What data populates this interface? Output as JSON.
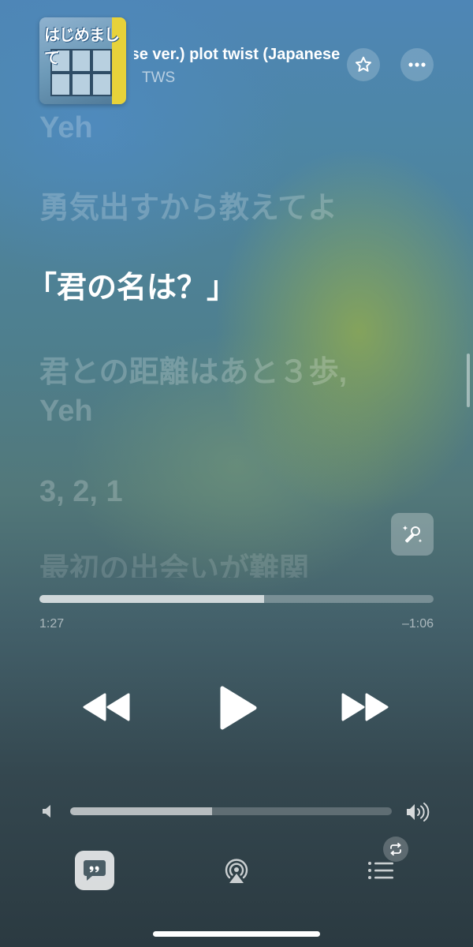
{
  "header": {
    "album_art_title": "はじめまして",
    "track_title": "(Japanese ver.)        plot twist (Japanese ver.)",
    "artist": "TWS"
  },
  "icons": {
    "favorite": "star-icon",
    "more": "ellipsis-icon",
    "sing": "karaoke-mic-icon",
    "rewind": "backward-icon",
    "play": "play-icon",
    "forward": "forward-icon",
    "volume_low": "speaker-low-icon",
    "volume_high": "speaker-high-icon",
    "lyrics": "lyrics-quote-icon",
    "airplay": "airplay-icon",
    "queue": "queue-list-icon",
    "repeat": "repeat-icon"
  },
  "lyrics": {
    "previous_partial": "Yeh",
    "line1": "勇気出すから教えてよ",
    "active": "「君の名は？」",
    "line3a": "君との距離はあと３歩,",
    "line3b": "Yeh",
    "line4": "3, 2, 1",
    "line5_partial": "最初の出会いが難関"
  },
  "playback": {
    "elapsed": "1:27",
    "remaining": "–1:06",
    "progress_fraction": 0.57
  },
  "volume": {
    "level_fraction": 0.44
  },
  "colors": {
    "background_top": "#4e86b6",
    "background_bottom": "#2b3a41",
    "glow_green": "#96af4b"
  }
}
